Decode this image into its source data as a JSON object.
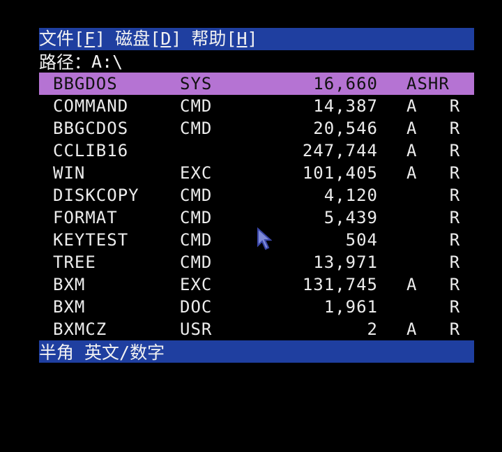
{
  "menubar": {
    "items": [
      {
        "label": "文件",
        "hotkey": "F"
      },
      {
        "label": "磁盘",
        "hotkey": "D"
      },
      {
        "label": "帮助",
        "hotkey": "H"
      }
    ]
  },
  "path": {
    "label": "路径：",
    "value": "A:\\"
  },
  "files": [
    {
      "name": "BBGDOS",
      "ext": "SYS",
      "size": "16,660",
      "attr": "ASHR"
    },
    {
      "name": "COMMAND",
      "ext": "CMD",
      "size": "14,387",
      "attr": "A   R"
    },
    {
      "name": "BBGCDOS",
      "ext": "CMD",
      "size": "20,546",
      "attr": "A   R"
    },
    {
      "name": "CCLIB16",
      "ext": "",
      "size": "247,744",
      "attr": "A   R"
    },
    {
      "name": "WIN",
      "ext": "EXC",
      "size": "101,405",
      "attr": "A   R"
    },
    {
      "name": "DISKCOPY",
      "ext": "CMD",
      "size": "4,120",
      "attr": "    R"
    },
    {
      "name": "FORMAT",
      "ext": "CMD",
      "size": "5,439",
      "attr": "    R"
    },
    {
      "name": "KEYTEST",
      "ext": "CMD",
      "size": "504",
      "attr": "    R"
    },
    {
      "name": "TREE",
      "ext": "CMD",
      "size": "13,971",
      "attr": "    R"
    },
    {
      "name": "BXM",
      "ext": "EXC",
      "size": "131,745",
      "attr": "A   R"
    },
    {
      "name": "BXM",
      "ext": "DOC",
      "size": "1,961",
      "attr": "    R"
    },
    {
      "name": "BXMCZ",
      "ext": "USR",
      "size": "2",
      "attr": "A   R"
    }
  ],
  "status": {
    "text": "半角 英文/数字"
  },
  "colors": {
    "bar_blue": "#1f3fa0",
    "selection": "#b573d3",
    "text": "#ececec"
  },
  "icons": {
    "cursor": "mouse-pointer-arrow"
  }
}
